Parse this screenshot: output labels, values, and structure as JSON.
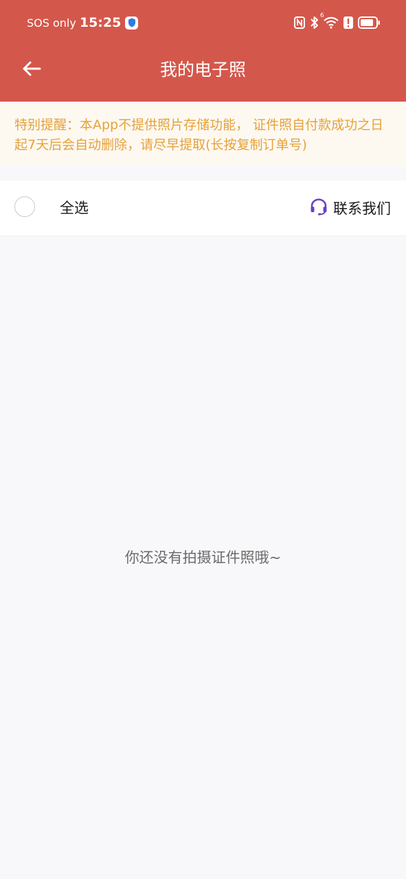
{
  "status_bar": {
    "carrier": "SOS only",
    "time": "15:25",
    "icons": [
      "shield-icon",
      "nfc-icon",
      "bluetooth-icon",
      "wifi-icon",
      "alert-icon",
      "battery-icon"
    ],
    "wifi_badge": "6"
  },
  "header": {
    "title": "我的电子照",
    "back_icon": "arrow-left-icon",
    "background_color": "#d4574b"
  },
  "notice": {
    "text": "特别提醒：本App不提供照片存储功能， 证件照自付款成功之日起7天后会自动删除，请尽早提取(长按复制订单号)",
    "color": "#e7a13a"
  },
  "toolbar": {
    "select_all_label": "全选",
    "select_all_checked": false,
    "contact_label": "联系我们",
    "contact_icon": "headset-icon",
    "contact_icon_color": "#6a3fc9"
  },
  "empty_state": {
    "message": "你还没有拍摄证件照哦~"
  }
}
